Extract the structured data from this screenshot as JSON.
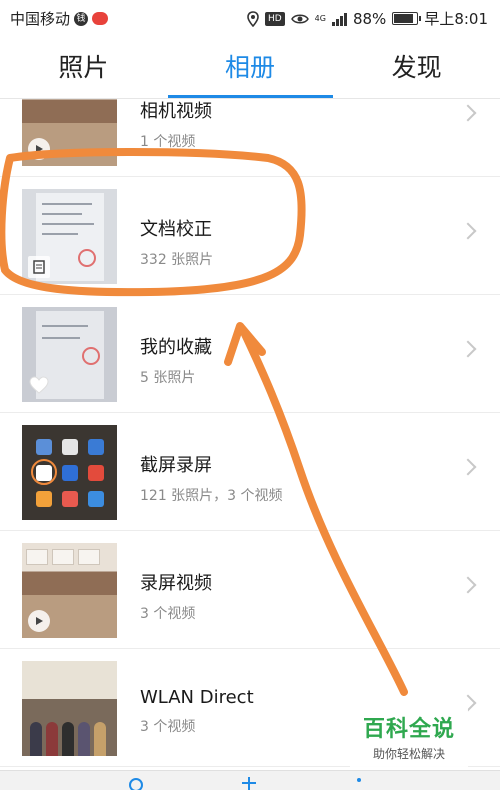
{
  "status_bar": {
    "carrier": "中国移动",
    "carrier_badge": "钱",
    "hd": "HD",
    "network": "4G",
    "battery_percent": "88%",
    "battery_level": 0.88,
    "time": "早上8:01",
    "icons": [
      "location-icon",
      "eye-icon",
      "signal-icon",
      "battery-icon"
    ]
  },
  "tabs": [
    {
      "label": "照片",
      "active": false
    },
    {
      "label": "相册",
      "active": true
    },
    {
      "label": "发现",
      "active": false
    }
  ],
  "accent_color": "#1e8ae6",
  "albums": [
    {
      "name": "相机视频",
      "count": "1 个视频",
      "badge": "play-icon"
    },
    {
      "name": "文档校正",
      "count": "332 张照片",
      "badge": "document-icon"
    },
    {
      "name": "我的收藏",
      "count": "5 张照片",
      "badge": "heart-icon"
    },
    {
      "name": "截屏录屏",
      "count": "121 张照片，3 个视频",
      "badge": ""
    },
    {
      "name": "录屏视频",
      "count": "3 个视频",
      "badge": "play-icon"
    },
    {
      "name": "WLAN Direct",
      "count": "3 个视频",
      "badge": ""
    }
  ],
  "annotation_color": "#f08a3c",
  "watermark": {
    "title": "百科全说",
    "subtitle": "助你轻松解决"
  },
  "bottom_bar": {
    "icons": [
      "search-icon",
      "add-icon",
      "more-icon"
    ]
  }
}
